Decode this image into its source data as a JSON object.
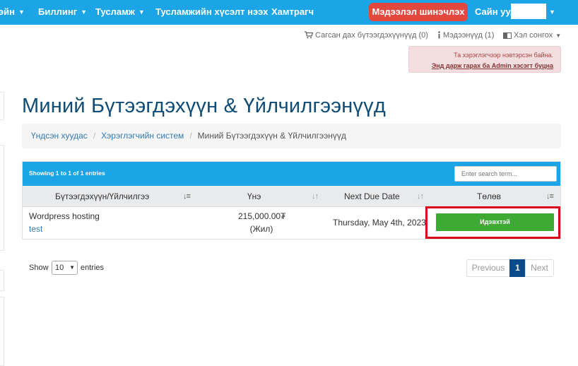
{
  "nav": {
    "items": [
      "эйн",
      "Биллинг",
      "Тусламж",
      "Тусламжийн хүсэлт нээх",
      "Хамтрагч"
    ],
    "update_button": "Мэдээлэл шинэчлэх",
    "greeting": "Сайн уу,"
  },
  "utility": {
    "cart": "Сагсан дах бүтээгдэхүүнүүд (0)",
    "notifications": "Мэдээнүүд (1)",
    "language": "Хэл сонгох"
  },
  "admin_alert": {
    "message": "Та хэрэглэгчээр нэвтэрсэн байна.",
    "link": "Энд дарж гарах ба Admin хэсэгт буцна"
  },
  "page": {
    "title": "Миний Бүтээгдэхүүн & Үйлчилгээнүүд",
    "breadcrumb": [
      "Үндсэн хуудас",
      "Хэрэглэгчийн систем",
      "Миний Бүтээгдэхүүн & Үйлчилгээнүүд"
    ]
  },
  "table": {
    "showing": "Showing 1 to 1 of 1 entries",
    "search_placeholder": "Enter search term...",
    "columns": [
      "Бүтээгдэхүүн/Үйлчилгээ",
      "Үнэ",
      "Next Due Date",
      "Төлөв"
    ],
    "rows": [
      {
        "product": "Wordpress hosting",
        "domain": "test",
        "price": "215,000.00₮",
        "cycle": "(Жил)",
        "due": "Thursday, May 4th, 2023",
        "status": "Идэвхтэй"
      }
    ]
  },
  "footer": {
    "show": "Show",
    "entries_value": "10",
    "entries": "entries",
    "prev": "Previous",
    "page": "1",
    "next": "Next"
  },
  "colors": {
    "nav": "#1ba4e6",
    "update_button": "#e2483d",
    "status_active": "#3fa936",
    "highlight": "#d9001b",
    "title": "#0f4c75"
  }
}
